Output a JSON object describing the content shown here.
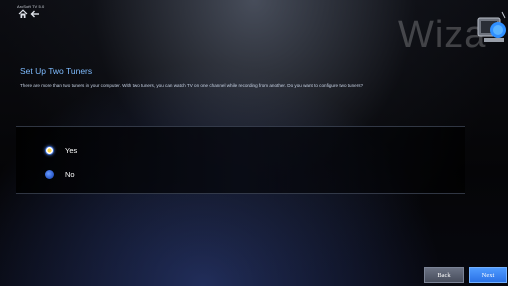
{
  "app": {
    "name": "ArcSoft TV 5.0",
    "wizard_title": "Wiza"
  },
  "icons": {
    "home": "home-icon",
    "back": "back-arrow-icon",
    "logo": "tv-tuner-logo-icon"
  },
  "page": {
    "heading": "Set Up Two Tuners",
    "description": "There are more than two tuners in your computer. With two tuners, you can watch TV on one channel while recording from another. Do you want to configure two tuners?"
  },
  "options": [
    {
      "label": "Yes",
      "selected": true
    },
    {
      "label": "No",
      "selected": false
    }
  ],
  "buttons": {
    "back_label": "Back",
    "next_label": "Next"
  },
  "colors": {
    "heading": "#7fbcff",
    "next_button": "#2b72e6",
    "back_button": "#474d5c",
    "radio_selected_center": "#ffd84a"
  }
}
